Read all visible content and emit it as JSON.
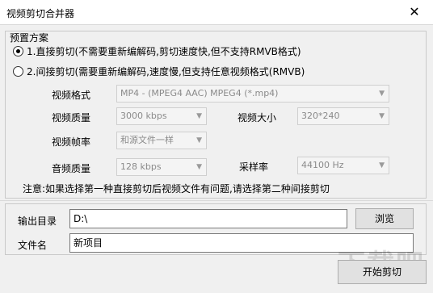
{
  "window": {
    "title": "视频剪切合并器",
    "close_glyph": "✕"
  },
  "preset": {
    "group_title": "预置方案",
    "option1_label": "1.直接剪切(不需要重新编解码,剪切速度快,但不支持RMVB格式)",
    "option2_label": "2.间接剪切(需要重新编解码,速度慢,但支持任意视频格式(RMVB)",
    "selected_option": 1
  },
  "settings": {
    "video_format_label": "视频格式",
    "video_format_value": "MP4 - (MPEG4 AAC) MPEG4 (*.mp4)",
    "video_quality_label": "视频质量",
    "video_quality_value": "3000 kbps",
    "video_size_label": "视频大小",
    "video_size_value": "320*240",
    "frame_rate_label": "视频帧率",
    "frame_rate_value": "和源文件一样",
    "audio_quality_label": "音频质量",
    "audio_quality_value": "128 kbps",
    "sample_rate_label": "采样率",
    "sample_rate_value": "44100 Hz"
  },
  "note": "注意:如果选择第一种直接剪切后视频文件有问题,请选择第二种间接剪切",
  "output": {
    "dir_label": "输出目录",
    "dir_value": "D:\\",
    "browse_label": "浏览",
    "filename_label": "文件名",
    "filename_value": "新项目"
  },
  "actions": {
    "start_label": "开始剪切"
  },
  "watermark": "下载吧"
}
